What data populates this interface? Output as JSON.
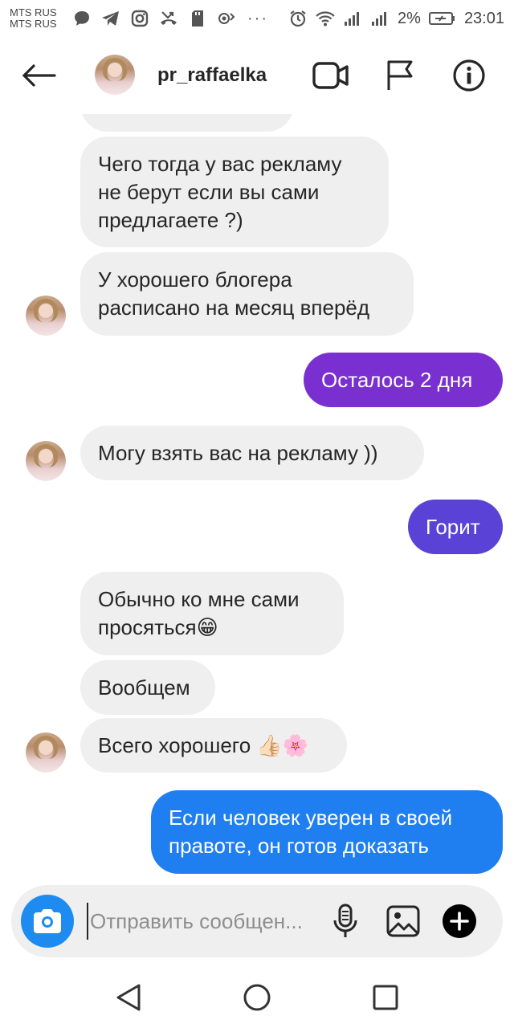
{
  "status_bar": {
    "carrier_1": "MTS RUS",
    "carrier_2": "MTS RUS",
    "battery": "2%",
    "time": "23:01",
    "left_icons": [
      "message-icon",
      "telegram-icon",
      "instagram-icon",
      "missed-call-icon",
      "sd-card-icon",
      "hotspot-icon"
    ],
    "right_icons": [
      "alarm-icon",
      "wifi-icon",
      "signal-icon",
      "signal-icon",
      "battery-icon"
    ]
  },
  "header": {
    "username": "pr_raffaelka",
    "icons": [
      "back-arrow-icon",
      "video-call-icon",
      "flag-icon",
      "info-icon"
    ]
  },
  "messages": [
    {
      "side": "in",
      "text": "Чего тогда у вас рекламу\nне берут если вы сами\nпредлагаете ?)"
    },
    {
      "side": "in",
      "text": "У хорошего блогера\nрасписано на месяц вперёд",
      "avatar": true
    },
    {
      "side": "out",
      "text": "Осталось 2 дня",
      "color": "#7a2fd1"
    },
    {
      "side": "in",
      "text": "Могу взять вас на рекламу ))",
      "avatar": true
    },
    {
      "side": "out",
      "text": "Горит",
      "color": "#5b42d6"
    },
    {
      "side": "in",
      "text": "Обычно ко мне сами\nпросяться😁"
    },
    {
      "side": "in",
      "text": "Вообщем"
    },
    {
      "side": "in",
      "text": "Всего хорошего 👍🏻🌸",
      "avatar": true
    },
    {
      "side": "out",
      "text": "Если человек уверен в своей\nправоте, он готов доказать",
      "color": "#1f7ef0"
    }
  ],
  "composer": {
    "placeholder": "Отправить сообщен...",
    "icons": [
      "camera-icon",
      "microphone-icon",
      "gallery-icon",
      "plus-icon"
    ]
  },
  "nav": {
    "icons": [
      "back-triangle-icon",
      "home-circle-icon",
      "recents-square-icon"
    ]
  },
  "colors": {
    "incoming_bubble": "#efefef",
    "camera_button": "#1d8bf0"
  }
}
